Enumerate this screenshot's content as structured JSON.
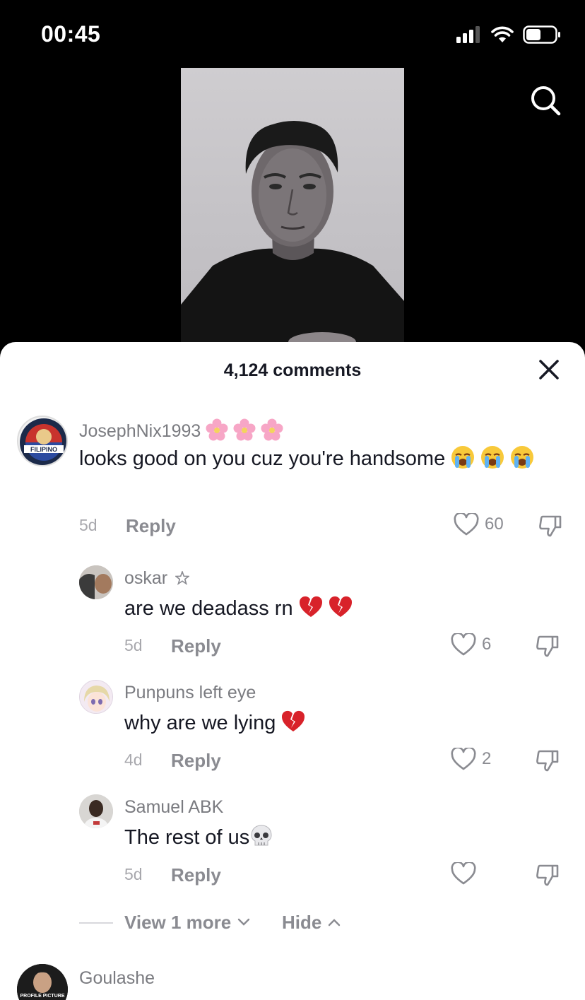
{
  "status_bar": {
    "time": "00:45"
  },
  "comments_sheet": {
    "title": "4,124 comments",
    "comments": [
      {
        "username": "JosephNix1993",
        "text": "looks good on you cuz you're handsome",
        "time": "5d",
        "reply_label": "Reply",
        "likes": "60",
        "avatar_text": "FILIPINO"
      }
    ],
    "replies": [
      {
        "username": "oskar",
        "text": "are we deadass rn",
        "time": "5d",
        "reply_label": "Reply",
        "likes": "6"
      },
      {
        "username": "Punpuns left eye",
        "text": "why are we lying",
        "time": "4d",
        "reply_label": "Reply",
        "likes": "2"
      },
      {
        "username": "Samuel ABK",
        "text": "The rest of us",
        "time": "5d",
        "reply_label": "Reply",
        "likes": ""
      }
    ],
    "view_more_label": "View 1 more",
    "hide_label": "Hide",
    "next_comment": {
      "username": "Goulashe",
      "avatar_text": "PROFILE PICTURE"
    }
  }
}
